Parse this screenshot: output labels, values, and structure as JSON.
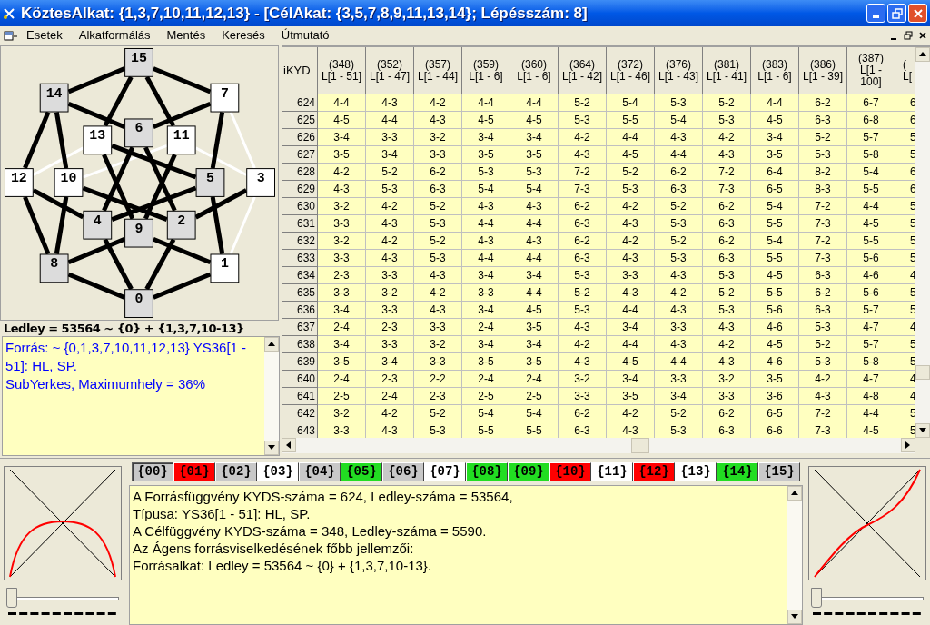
{
  "window": {
    "title": "KöztesAlkat: {1,3,7,10,11,12,13} - [CélAkat: {3,5,7,8,9,11,13,14}; Lépésszám: 8]"
  },
  "menu": [
    "Esetek",
    "Alkatformálás",
    "Mentés",
    "Keresés",
    "Útmutató"
  ],
  "graph": {
    "nodes": [
      {
        "label": "0",
        "in_set": false
      },
      {
        "label": "1",
        "in_set": true
      },
      {
        "label": "2",
        "in_set": false
      },
      {
        "label": "3",
        "in_set": true
      },
      {
        "label": "4",
        "in_set": false
      },
      {
        "label": "5",
        "in_set": false
      },
      {
        "label": "6",
        "in_set": false
      },
      {
        "label": "7",
        "in_set": true
      },
      {
        "label": "8",
        "in_set": false
      },
      {
        "label": "9",
        "in_set": false
      },
      {
        "label": "10",
        "in_set": true
      },
      {
        "label": "11",
        "in_set": true
      },
      {
        "label": "12",
        "in_set": true
      },
      {
        "label": "13",
        "in_set": true
      },
      {
        "label": "14",
        "in_set": false
      },
      {
        "label": "15",
        "in_set": false
      }
    ],
    "caption": "Ledley = 53564 ~ {0} + {1,3,7,10-13}"
  },
  "source_note": {
    "lines": [
      "Forrás: ~ {0,1,3,7,10,11,12,13} YS36[1 - 51]: HL, SP.",
      "SubYerkes, Maximumhely = 36%"
    ]
  },
  "table": {
    "corner": "iKYD",
    "columns": [
      {
        "lines": [
          "(348)",
          "L[1 - 51]"
        ]
      },
      {
        "lines": [
          "(352)",
          "L[1 - 47]"
        ]
      },
      {
        "lines": [
          "(357)",
          "L[1 - 44]"
        ]
      },
      {
        "lines": [
          "(359)",
          "L[1 - 6]"
        ]
      },
      {
        "lines": [
          "(360)",
          "L[1 - 6]"
        ]
      },
      {
        "lines": [
          "(364)",
          "L[1 - 42]"
        ]
      },
      {
        "lines": [
          "(372)",
          "L[1 - 46]"
        ]
      },
      {
        "lines": [
          "(376)",
          "L[1 - 43]"
        ]
      },
      {
        "lines": [
          "(381)",
          "L[1 - 41]"
        ]
      },
      {
        "lines": [
          "(383)",
          "L[1 - 6]"
        ]
      },
      {
        "lines": [
          "(386)",
          "L[1 - 39]"
        ]
      },
      {
        "lines": [
          "(387)",
          "L[1 -",
          "100]"
        ]
      },
      {
        "lines": [
          "(",
          "L["
        ],
        "kind": "partial"
      }
    ],
    "rows": [
      {
        "header": "624",
        "cells": [
          "4-4",
          "4-3",
          "4-2",
          "4-4",
          "4-4",
          "5-2",
          "5-4",
          "5-3",
          "5-2",
          "4-4",
          "6-2",
          "6-7",
          "6"
        ]
      },
      {
        "header": "625",
        "cells": [
          "4-5",
          "4-4",
          "4-3",
          "4-5",
          "4-5",
          "5-3",
          "5-5",
          "5-4",
          "5-3",
          "4-5",
          "6-3",
          "6-8",
          "6"
        ]
      },
      {
        "header": "626",
        "cells": [
          "3-4",
          "3-3",
          "3-2",
          "3-4",
          "3-4",
          "4-2",
          "4-4",
          "4-3",
          "4-2",
          "3-4",
          "5-2",
          "5-7",
          "5"
        ]
      },
      {
        "header": "627",
        "cells": [
          "3-5",
          "3-4",
          "3-3",
          "3-5",
          "3-5",
          "4-3",
          "4-5",
          "4-4",
          "4-3",
          "3-5",
          "5-3",
          "5-8",
          "5"
        ]
      },
      {
        "header": "628",
        "cells": [
          "4-2",
          "5-2",
          "6-2",
          "5-3",
          "5-3",
          "7-2",
          "5-2",
          "6-2",
          "7-2",
          "6-4",
          "8-2",
          "5-4",
          "6"
        ]
      },
      {
        "header": "629",
        "cells": [
          "4-3",
          "5-3",
          "6-3",
          "5-4",
          "5-4",
          "7-3",
          "5-3",
          "6-3",
          "7-3",
          "6-5",
          "8-3",
          "5-5",
          "6"
        ]
      },
      {
        "header": "630",
        "cells": [
          "3-2",
          "4-2",
          "5-2",
          "4-3",
          "4-3",
          "6-2",
          "4-2",
          "5-2",
          "6-2",
          "5-4",
          "7-2",
          "4-4",
          "5"
        ]
      },
      {
        "header": "631",
        "cells": [
          "3-3",
          "4-3",
          "5-3",
          "4-4",
          "4-4",
          "6-3",
          "4-3",
          "5-3",
          "6-3",
          "5-5",
          "7-3",
          "4-5",
          "5"
        ]
      },
      {
        "header": "632",
        "cells": [
          "3-2",
          "4-2",
          "5-2",
          "4-3",
          "4-3",
          "6-2",
          "4-2",
          "5-2",
          "6-2",
          "5-4",
          "7-2",
          "5-5",
          "5"
        ]
      },
      {
        "header": "633",
        "cells": [
          "3-3",
          "4-3",
          "5-3",
          "4-4",
          "4-4",
          "6-3",
          "4-3",
          "5-3",
          "6-3",
          "5-5",
          "7-3",
          "5-6",
          "5"
        ]
      },
      {
        "header": "634",
        "cells": [
          "2-3",
          "3-3",
          "4-3",
          "3-4",
          "3-4",
          "5-3",
          "3-3",
          "4-3",
          "5-3",
          "4-5",
          "6-3",
          "4-6",
          "4"
        ]
      },
      {
        "header": "635",
        "cells": [
          "3-3",
          "3-2",
          "4-2",
          "3-3",
          "4-4",
          "5-2",
          "4-3",
          "4-2",
          "5-2",
          "5-5",
          "6-2",
          "5-6",
          "5"
        ]
      },
      {
        "header": "636",
        "cells": [
          "3-4",
          "3-3",
          "4-3",
          "3-4",
          "4-5",
          "5-3",
          "4-4",
          "4-3",
          "5-3",
          "5-6",
          "6-3",
          "5-7",
          "5"
        ]
      },
      {
        "header": "637",
        "cells": [
          "2-4",
          "2-3",
          "3-3",
          "2-4",
          "3-5",
          "4-3",
          "3-4",
          "3-3",
          "4-3",
          "4-6",
          "5-3",
          "4-7",
          "4"
        ]
      },
      {
        "header": "638",
        "cells": [
          "3-4",
          "3-3",
          "3-2",
          "3-4",
          "3-4",
          "4-2",
          "4-4",
          "4-3",
          "4-2",
          "4-5",
          "5-2",
          "5-7",
          "5"
        ]
      },
      {
        "header": "639",
        "cells": [
          "3-5",
          "3-4",
          "3-3",
          "3-5",
          "3-5",
          "4-3",
          "4-5",
          "4-4",
          "4-3",
          "4-6",
          "5-3",
          "5-8",
          "5"
        ]
      },
      {
        "header": "640",
        "cells": [
          "2-4",
          "2-3",
          "2-2",
          "2-4",
          "2-4",
          "3-2",
          "3-4",
          "3-3",
          "3-2",
          "3-5",
          "4-2",
          "4-7",
          "4"
        ]
      },
      {
        "header": "641",
        "cells": [
          "2-5",
          "2-4",
          "2-3",
          "2-5",
          "2-5",
          "3-3",
          "3-5",
          "3-4",
          "3-3",
          "3-6",
          "4-3",
          "4-8",
          "4"
        ]
      },
      {
        "header": "642",
        "cells": [
          "3-2",
          "4-2",
          "5-2",
          "5-4",
          "5-4",
          "6-2",
          "4-2",
          "5-2",
          "6-2",
          "6-5",
          "7-2",
          "4-4",
          "5"
        ]
      },
      {
        "header": "643",
        "cells": [
          "3-3",
          "4-3",
          "5-3",
          "5-5",
          "5-5",
          "6-3",
          "4-3",
          "5-3",
          "6-3",
          "6-6",
          "7-3",
          "4-5",
          "5"
        ]
      }
    ]
  },
  "subset_tabs": [
    {
      "label": "{00}",
      "color": "#c8c8c8",
      "selected": true
    },
    {
      "label": "{01}",
      "color": "#ff0000",
      "selected": false
    },
    {
      "label": "{02}",
      "color": "#c8c8c8",
      "selected": false
    },
    {
      "label": "{03}",
      "color": "#ffffff",
      "selected": false
    },
    {
      "label": "{04}",
      "color": "#c8c8c8",
      "selected": false
    },
    {
      "label": "{05}",
      "color": "#22dd22",
      "selected": false
    },
    {
      "label": "{06}",
      "color": "#c8c8c8",
      "selected": false
    },
    {
      "label": "{07}",
      "color": "#ffffff",
      "selected": false
    },
    {
      "label": "{08}",
      "color": "#22dd22",
      "selected": false
    },
    {
      "label": "{09}",
      "color": "#22dd22",
      "selected": false
    },
    {
      "label": "{10}",
      "color": "#ff0000",
      "selected": false
    },
    {
      "label": "{11}",
      "color": "#ffffff",
      "selected": false
    },
    {
      "label": "{12}",
      "color": "#ff0000",
      "selected": false
    },
    {
      "label": "{13}",
      "color": "#ffffff",
      "selected": false
    },
    {
      "label": "{14}",
      "color": "#22dd22",
      "selected": false
    },
    {
      "label": "{15}",
      "color": "#c8c8c8",
      "selected": false
    }
  ],
  "report": {
    "lines": [
      "A Forrásfüggvény KYDS-száma = 624, Ledley-száma = 53564,",
      "Típusa: YS36[1 - 51]: HL, SP.",
      "A Célfüggvény KYDS-száma = 348, Ledley-száma = 5590.",
      "Az Ágens forrásviselkedésének főbb jellemzői:",
      "Forrásalkat: Ledley = 53564 ~ {0} + {1,3,7,10-13}."
    ]
  },
  "sliders": [
    {
      "level": 0
    },
    {
      "level": 0
    }
  ]
}
